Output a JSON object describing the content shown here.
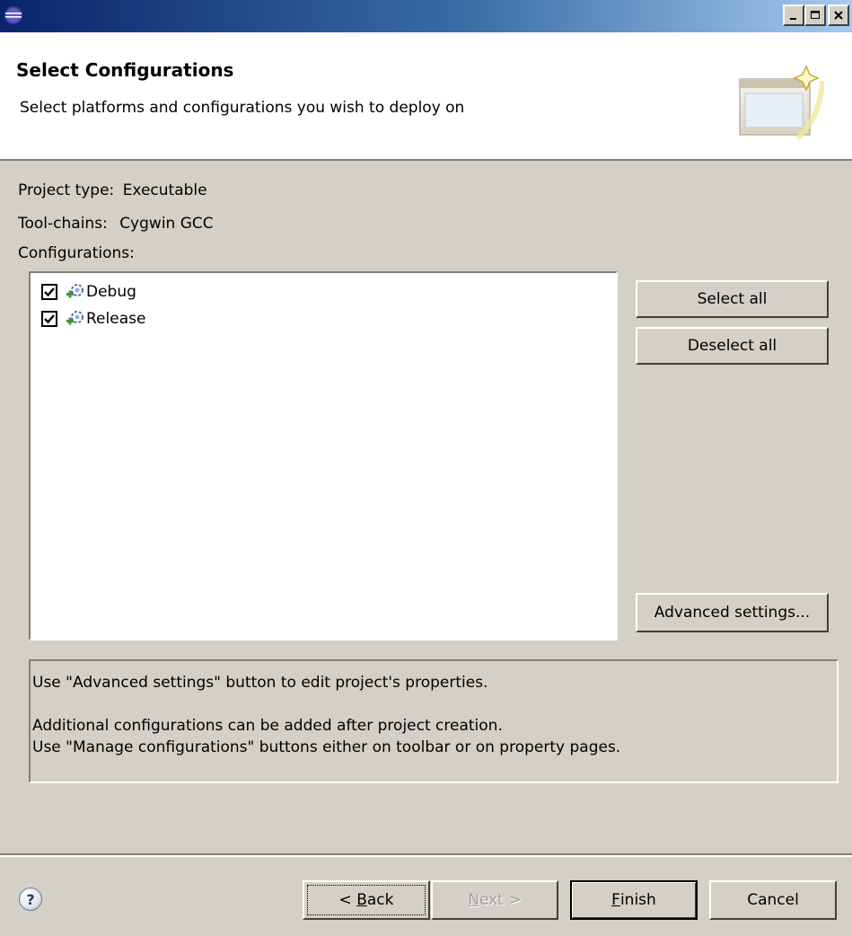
{
  "window": {
    "title": ""
  },
  "header": {
    "title": "Select Configurations",
    "description": "Select platforms and configurations you wish to deploy on"
  },
  "info": {
    "project_type_label": "Project type:",
    "project_type_value": "Executable",
    "toolchains_label": "Tool-chains:",
    "toolchains_value": "Cygwin GCC",
    "configurations_label": "Configurations:"
  },
  "configurations": [
    {
      "name": "Debug",
      "checked": true
    },
    {
      "name": "Release",
      "checked": true
    }
  ],
  "side_buttons": {
    "select_all": "Select all",
    "deselect_all": "Deselect all",
    "advanced": "Advanced settings..."
  },
  "note": {
    "line1": "Use \"Advanced settings\" button to edit project's properties.",
    "line2": "Additional configurations can be added after project creation.",
    "line3": "Use \"Manage configurations\" buttons either on toolbar or on property pages."
  },
  "footer": {
    "back_prefix": "< ",
    "back_mnemonic": "B",
    "back_rest": "ack",
    "next_mnemonic": "N",
    "next_rest": "ext >",
    "finish_mnemonic": "F",
    "finish_rest": "inish",
    "cancel": "Cancel",
    "help_glyph": "?"
  },
  "colors": {
    "titlebar_start": "#0a246a",
    "titlebar_end": "#a6caf0",
    "dialog_bg": "#d4d0c8",
    "config_icon_green": "#3c9a2a"
  }
}
